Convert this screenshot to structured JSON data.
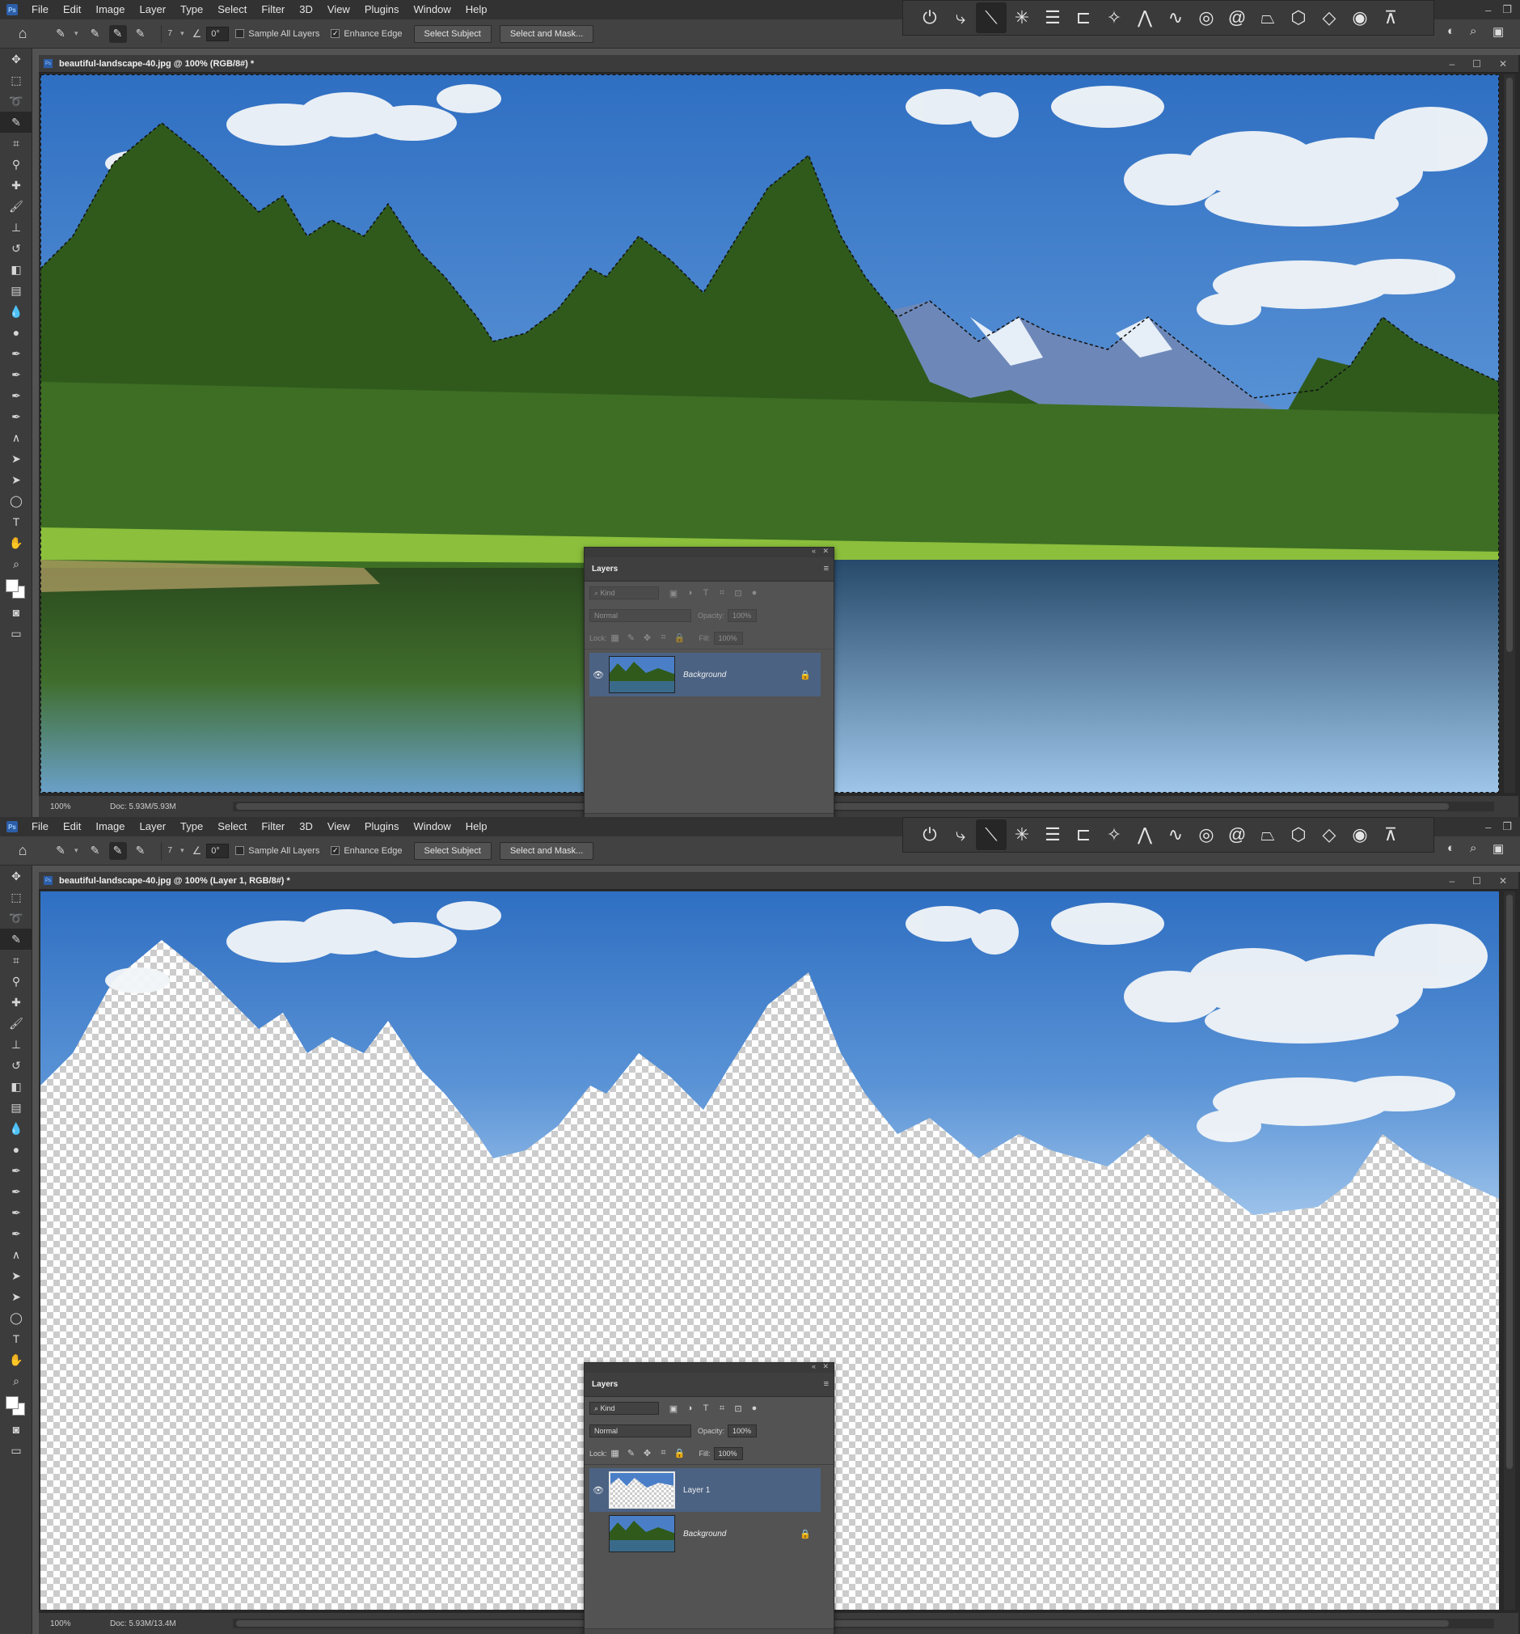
{
  "menu": [
    "File",
    "Edit",
    "Image",
    "Layer",
    "Type",
    "Select",
    "Filter",
    "3D",
    "View",
    "Plugins",
    "Window",
    "Help"
  ],
  "options": {
    "brush_size": "7",
    "angle": "0°",
    "sample_all_layers": "Sample All Layers",
    "enhance_edge": "Enhance Edge",
    "select_subject": "Select Subject",
    "select_and_mask": "Select and Mask..."
  },
  "screen1": {
    "doc_title": "beautiful-landscape-40.jpg @ 100% (RGB/8#) *",
    "zoom": "100%",
    "doc_size": "Doc: 5.93M/5.93M",
    "layers": {
      "panel_title": "Layers",
      "kind_label": "Kind",
      "blend_mode": "Normal",
      "opacity_label": "Opacity:",
      "opacity_value": "100%",
      "lock_label": "Lock:",
      "fill_label": "Fill:",
      "fill_value": "100%",
      "items": [
        {
          "name": "Background",
          "locked": true,
          "selected": true
        }
      ]
    }
  },
  "screen2": {
    "doc_title": "beautiful-landscape-40.jpg @ 100% (Layer 1, RGB/8#) *",
    "zoom": "100%",
    "doc_size": "Doc: 5.93M/13.4M",
    "layers": {
      "panel_title": "Layers",
      "kind_label": "Kind",
      "blend_mode": "Normal",
      "opacity_label": "Opacity:",
      "opacity_value": "100%",
      "lock_label": "Lock:",
      "fill_label": "Fill:",
      "fill_value": "100%",
      "items": [
        {
          "name": "Layer 1",
          "locked": false,
          "selected": true
        },
        {
          "name": "Background",
          "locked": true,
          "selected": false
        }
      ]
    }
  },
  "colors": {
    "selection_highlight": "#4b6283",
    "sky": "#3f7dc9",
    "forest": "#2f5a1c"
  },
  "icons": {
    "app": "photoshop-logo-icon",
    "home": "home-icon",
    "quick_selection": "quick-selection-brush-icon"
  }
}
